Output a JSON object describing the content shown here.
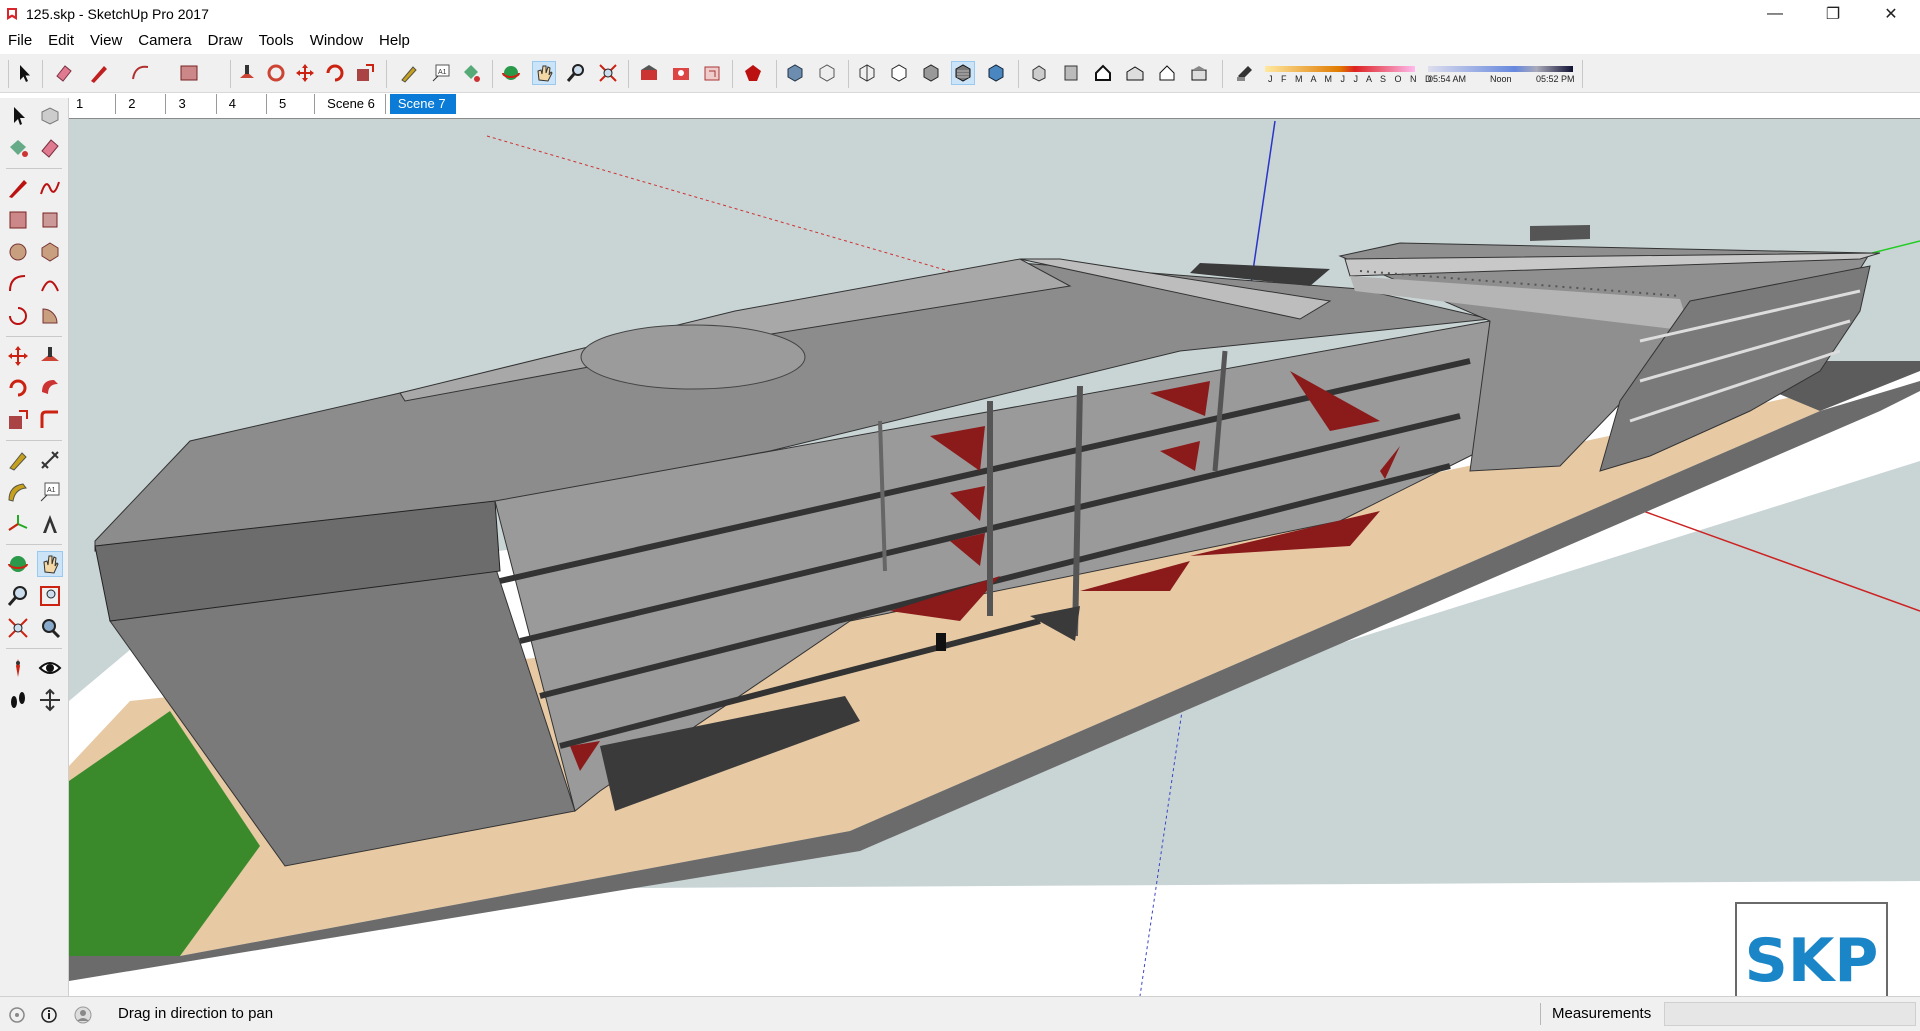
{
  "window": {
    "title": "125.skp - SketchUp Pro 2017",
    "minimize_glyph": "—",
    "maximize_glyph": "❐",
    "close_glyph": "✕"
  },
  "menu": [
    "File",
    "Edit",
    "View",
    "Camera",
    "Draw",
    "Tools",
    "Window",
    "Help"
  ],
  "shadow_settings": {
    "months": "J F M A M J J A S O N D",
    "time_start": "05:54 AM",
    "time_mid": "Noon",
    "time_end": "05:52 PM"
  },
  "scenes": {
    "tabs": [
      "1",
      "2",
      "3",
      "4",
      "5",
      "Scene 6",
      "Scene 7"
    ],
    "active_index": 6
  },
  "status": {
    "message": "Drag in direction to pan",
    "measurements_label": "Measurements",
    "measurements_value": ""
  },
  "watermark": "SKP",
  "colors": {
    "accent": "#0a7bd6",
    "sky": "#c9d4d5",
    "ground": "#ffffff",
    "building": "#8c8c8c",
    "red_accent": "#8b1a1a",
    "pavement": "#e8c9a2",
    "grass": "#3a8a2c"
  },
  "icons": {
    "app": "sketchup-icon",
    "active_tool": "pan-icon"
  }
}
